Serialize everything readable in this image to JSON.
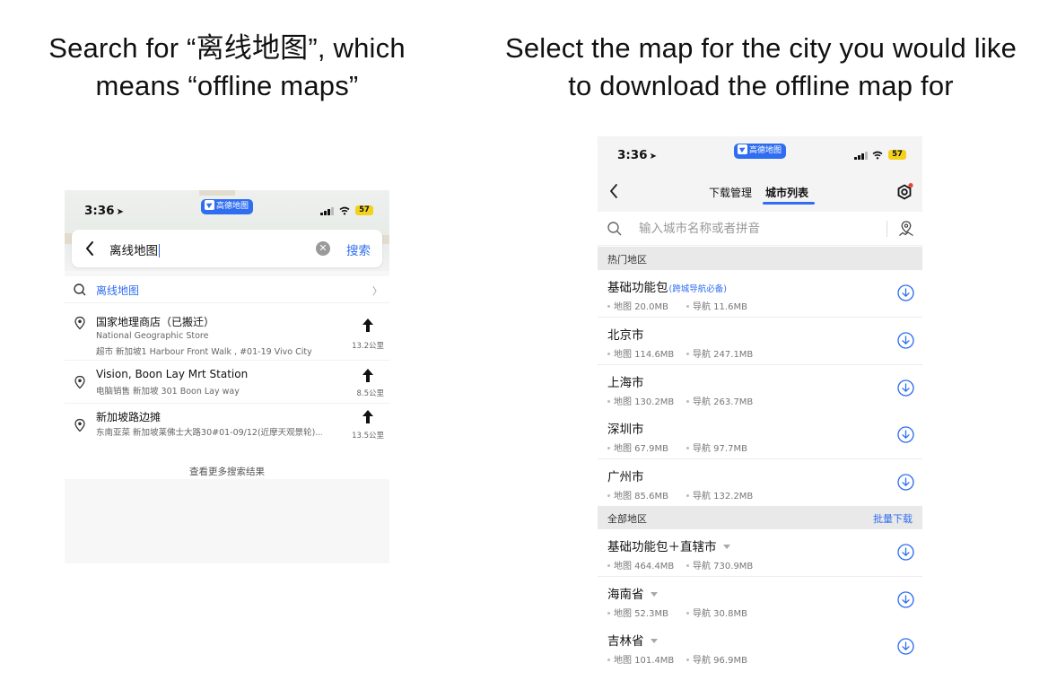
{
  "captions": {
    "left": "Search for “离线地图”, which means “offline maps”",
    "right": "Select the map for the city you would like to download the offline map for"
  },
  "status_bar": {
    "time": "3:36",
    "app_badge": "高德地图",
    "battery": "57"
  },
  "search_screen": {
    "query": "离线地图",
    "search_button": "搜索",
    "suggestion": "离线地图",
    "results": [
      {
        "title": "国家地理商店（已搬迁）",
        "subtitle_en": "National Geographic Store",
        "detail": "超市  新加坡1 Harbour Front Walk , #01-19 Vivo City",
        "distance": "13.2公里"
      },
      {
        "title": "Vision, Boon Lay Mrt Station",
        "detail": "电脑销售  新加坡 301 Boon Lay way",
        "distance": "8.5公里"
      },
      {
        "title": "新加坡路边摊",
        "detail": "东南亚菜  新加坡莱佛士大路30#01-09/12(近摩天观景轮)...",
        "distance": "13.5公里"
      }
    ],
    "more_results": "查看更多搜索结果"
  },
  "city_list_screen": {
    "tabs": [
      "下载管理",
      "城市列表"
    ],
    "active_tab": "城市列表",
    "search_placeholder": "输入城市名称或者拼音",
    "hot_section": {
      "label": "热门地区",
      "items": [
        {
          "name": "基础功能包",
          "tag": "(跨城导航必备)",
          "map_size": "地图 20.0MB",
          "nav_size": "导航 11.6MB",
          "expandable": false
        },
        {
          "name": "北京市",
          "map_size": "地图 114.6MB",
          "nav_size": "导航 247.1MB",
          "expandable": false
        },
        {
          "name": "上海市",
          "map_size": "地图 130.2MB",
          "nav_size": "导航 263.7MB",
          "expandable": false
        },
        {
          "name": "深圳市",
          "map_size": "地图 67.9MB",
          "nav_size": "导航 97.7MB",
          "expandable": false
        },
        {
          "name": "广州市",
          "map_size": "地图 85.6MB",
          "nav_size": "导航 132.2MB",
          "expandable": false
        }
      ]
    },
    "all_section": {
      "label": "全部地区",
      "action": "批量下载",
      "items": [
        {
          "name": "基础功能包＋直辖市",
          "map_size": "地图 464.4MB",
          "nav_size": "导航 730.9MB",
          "expandable": true
        },
        {
          "name": "海南省",
          "map_size": "地图 52.3MB",
          "nav_size": "导航 30.8MB",
          "expandable": true
        },
        {
          "name": "吉林省",
          "map_size": "地图 101.4MB",
          "nav_size": "导航 96.9MB",
          "expandable": true
        }
      ]
    }
  },
  "colors": {
    "accent": "#2f6ef0",
    "battery": "#f2d21c",
    "section_bg": "#e9e9e9",
    "notification_dot": "#e8453c"
  },
  "icons": [
    "back-chevron-icon",
    "clear-icon",
    "search-icon",
    "location-pin-icon",
    "navigate-arrow-icon",
    "chevron-right-icon",
    "settings-icon",
    "locate-city-icon",
    "download-icon"
  ]
}
